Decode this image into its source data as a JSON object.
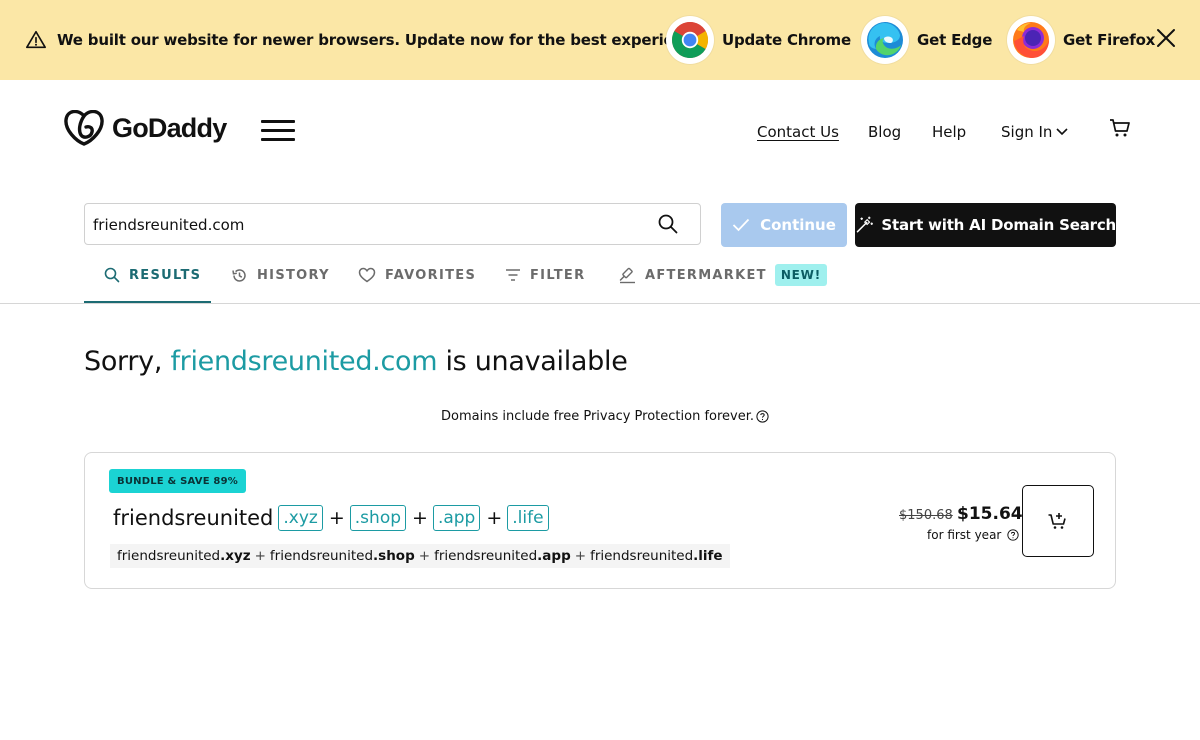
{
  "banner": {
    "message": "We built our website for newer browsers. Update now for the best experience.",
    "browsers": [
      {
        "label": "Update Chrome",
        "icon": "chrome-icon"
      },
      {
        "label": "Get Edge",
        "icon": "edge-icon"
      },
      {
        "label": "Get Firefox",
        "icon": "firefox-icon"
      }
    ],
    "background": "#fbe7a6"
  },
  "header": {
    "brand": "GoDaddy",
    "nav": {
      "contact": "Contact Us",
      "blog": "Blog",
      "help": "Help",
      "signin": "Sign In"
    }
  },
  "search": {
    "value": "friendsreunited.com",
    "continue_label": "Continue",
    "ai_label": "Start with AI Domain Search"
  },
  "tabs": [
    {
      "label": "RESULTS",
      "active": true
    },
    {
      "label": "HISTORY"
    },
    {
      "label": "FAVORITES"
    },
    {
      "label": "FILTER"
    },
    {
      "label": "AFTERMARKET",
      "badge": "NEW!"
    }
  ],
  "result": {
    "prefix": "Sorry, ",
    "domain": "friendsreunited.com",
    "suffix": " is unavailable",
    "privacy_note": "Domains include free Privacy Protection forever."
  },
  "bundle": {
    "badge": "BUNDLE & SAVE 89%",
    "name": "friendsreunited",
    "tlds": [
      ".xyz",
      ".shop",
      ".app",
      ".life"
    ],
    "plus": "+",
    "list_sld": "friendsreunited",
    "list_tlds": [
      ".xyz",
      ".shop",
      ".app",
      ".life"
    ],
    "price_old": "$150.68",
    "price_new": "$15.64",
    "price_term": "for first year"
  },
  "colors": {
    "accent_teal": "#1c9ba3",
    "tab_active": "#1c6b73",
    "continue_disabled": "#a9c9ee",
    "primary_dark": "#111111",
    "badge_bundle": "#1bd3d3",
    "badge_new": "#9ff0ee"
  }
}
